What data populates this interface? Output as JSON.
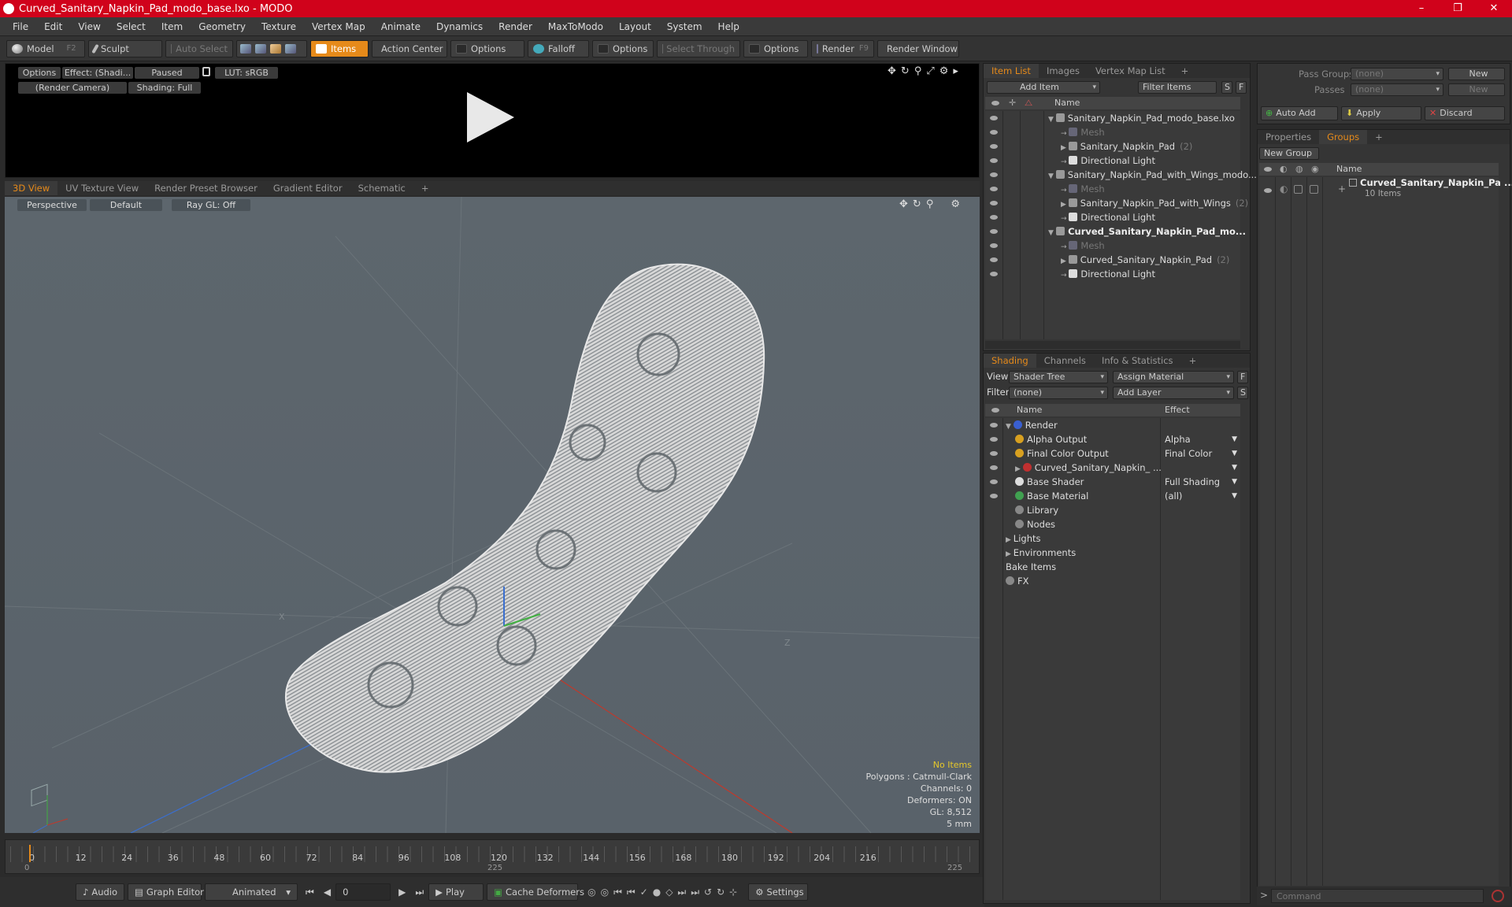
{
  "window": {
    "title": "Curved_Sanitary_Napkin_Pad_modo_base.lxo - MODO",
    "minimize": "–",
    "maximize": "❐",
    "close": "✕"
  },
  "menu": [
    "File",
    "Edit",
    "View",
    "Select",
    "Item",
    "Geometry",
    "Texture",
    "Vertex Map",
    "Animate",
    "Dynamics",
    "Render",
    "MaxToModo",
    "Layout",
    "System",
    "Help"
  ],
  "toolbar": {
    "model": "Model",
    "model_key": "F2",
    "sculpt": "Sculpt",
    "auto_select": "Auto Select",
    "items": "Items",
    "action_center": "Action Center",
    "options1": "Options",
    "falloff": "Falloff",
    "options2": "Options",
    "select_through": "Select Through",
    "options3": "Options",
    "render": "Render",
    "render_key": "F9",
    "render_window": "Render Window"
  },
  "preview": {
    "options": "Options",
    "effect": "Effect: (Shadi...",
    "paused": "Paused",
    "lut": "LUT: sRGB",
    "camera": "(Render Camera)",
    "shading": "Shading: Full"
  },
  "viewport_tabs": [
    "3D View",
    "UV Texture View",
    "Render Preset Browser",
    "Gradient Editor",
    "Schematic",
    "+"
  ],
  "viewport": {
    "perspective": "Perspective",
    "default": "Default",
    "raygl": "Ray GL: Off",
    "axis_x": "X",
    "axis_z": "Z"
  },
  "viewport_info": {
    "no_items": "No Items",
    "polygons": "Polygons : Catmull-Clark",
    "channels": "Channels: 0",
    "deformers": "Deformers: ON",
    "gl": "GL: 8,512",
    "scale": "5 mm"
  },
  "timeline": {
    "ticks": [
      "0",
      "12",
      "24",
      "36",
      "48",
      "60",
      "72",
      "84",
      "96",
      "108",
      "120",
      "132",
      "144",
      "156",
      "168",
      "180",
      "192",
      "204",
      "216"
    ],
    "start": "0",
    "mid": "225",
    "end": "225"
  },
  "bottom": {
    "audio": "Audio",
    "graph_editor": "Graph Editor",
    "animated": "Animated",
    "frame": "0",
    "play": "Play",
    "cache": "Cache Deformers",
    "settings": "Settings"
  },
  "item_list": {
    "tabs": [
      "Item List",
      "Images",
      "Vertex Map List",
      "+"
    ],
    "add_item": "Add Item",
    "filter": "Filter Items",
    "s": "S",
    "f": "F",
    "col_name": "Name",
    "rows": [
      {
        "label": "Sanitary_Napkin_Pad_modo_base.lxo",
        "indent": 0,
        "kind": "scene",
        "dim": false,
        "bold": false,
        "suffix": ""
      },
      {
        "label": "Mesh",
        "indent": 1,
        "kind": "mesh",
        "dim": true,
        "bold": false,
        "suffix": ""
      },
      {
        "label": "Sanitary_Napkin_Pad",
        "indent": 1,
        "kind": "group",
        "dim": false,
        "bold": false,
        "suffix": "(2)"
      },
      {
        "label": "Directional Light",
        "indent": 1,
        "kind": "light",
        "dim": false,
        "bold": false,
        "suffix": ""
      },
      {
        "label": "Sanitary_Napkin_Pad_with_Wings_modo...",
        "indent": 0,
        "kind": "scene",
        "dim": false,
        "bold": false,
        "suffix": ""
      },
      {
        "label": "Mesh",
        "indent": 1,
        "kind": "mesh",
        "dim": true,
        "bold": false,
        "suffix": ""
      },
      {
        "label": "Sanitary_Napkin_Pad_with_Wings",
        "indent": 1,
        "kind": "group",
        "dim": false,
        "bold": false,
        "suffix": "(2)"
      },
      {
        "label": "Directional Light",
        "indent": 1,
        "kind": "light",
        "dim": false,
        "bold": false,
        "suffix": ""
      },
      {
        "label": "Curved_Sanitary_Napkin_Pad_mo...",
        "indent": 0,
        "kind": "scene",
        "dim": false,
        "bold": true,
        "suffix": ""
      },
      {
        "label": "Mesh",
        "indent": 1,
        "kind": "mesh",
        "dim": true,
        "bold": false,
        "suffix": ""
      },
      {
        "label": "Curved_Sanitary_Napkin_Pad",
        "indent": 1,
        "kind": "group",
        "dim": false,
        "bold": false,
        "suffix": "(2)"
      },
      {
        "label": "Directional Light",
        "indent": 1,
        "kind": "light",
        "dim": false,
        "bold": false,
        "suffix": ""
      }
    ]
  },
  "shading": {
    "tabs": [
      "Shading",
      "Channels",
      "Info & Statistics",
      "+"
    ],
    "view_label": "View",
    "view_value": "Shader Tree",
    "assign": "Assign Material",
    "f": "F",
    "filter_label": "Filter",
    "filter_value": "(none)",
    "add_layer": "Add Layer",
    "s": "S",
    "col_name": "Name",
    "col_effect": "Effect",
    "rows": [
      {
        "label": "Render",
        "effect": "",
        "indent": 0,
        "color": "#3a5fd0",
        "eye": true
      },
      {
        "label": "Alpha Output",
        "effect": "Alpha",
        "indent": 1,
        "color": "#d8a020",
        "eye": true
      },
      {
        "label": "Final Color Output",
        "effect": "Final Color",
        "indent": 1,
        "color": "#d8a020",
        "eye": true
      },
      {
        "label": "Curved_Sanitary_Napkin_ ...",
        "effect": "",
        "indent": 1,
        "color": "#c03030",
        "eye": true
      },
      {
        "label": "Base Shader",
        "effect": "Full Shading",
        "indent": 1,
        "color": "#dddddd",
        "eye": true
      },
      {
        "label": "Base Material",
        "effect": "(all)",
        "indent": 1,
        "color": "#40a050",
        "eye": true
      },
      {
        "label": "Library",
        "effect": "",
        "indent": 1,
        "color": "#888888",
        "eye": false
      },
      {
        "label": "Nodes",
        "effect": "",
        "indent": 1,
        "color": "#888888",
        "eye": false
      },
      {
        "label": "Lights",
        "effect": "",
        "indent": 0,
        "color": "",
        "eye": false
      },
      {
        "label": "Environments",
        "effect": "",
        "indent": 0,
        "color": "",
        "eye": false
      },
      {
        "label": "Bake Items",
        "effect": "",
        "indent": 0,
        "color": "",
        "eye": false
      },
      {
        "label": "FX",
        "effect": "",
        "indent": 0,
        "color": "#888888",
        "eye": false
      }
    ]
  },
  "passes": {
    "pass_groups": "Pass Groups",
    "passes": "Passes",
    "none": "(none)",
    "new": "New",
    "auto_add": "Auto Add",
    "apply": "Apply",
    "discard": "Discard"
  },
  "groups": {
    "tabs": [
      "Properties",
      "Groups",
      "+"
    ],
    "new_group": "New Group",
    "col_name": "Name",
    "group_name": "Curved_Sanitary_Napkin_Pa ...",
    "group_count": "10 Items"
  },
  "command": {
    "placeholder": "Command"
  }
}
